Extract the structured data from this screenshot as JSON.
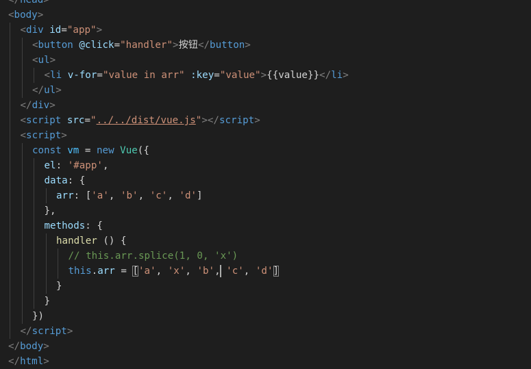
{
  "editor": {
    "lines": [
      {
        "indent": 0,
        "tokens": [
          {
            "c": "t-bracket",
            "t": "</"
          },
          {
            "c": "t-tag",
            "t": "head"
          },
          {
            "c": "t-bracket",
            "t": ">"
          }
        ]
      },
      {
        "indent": 0,
        "tokens": [
          {
            "c": "t-bracket",
            "t": "<"
          },
          {
            "c": "t-tag",
            "t": "body"
          },
          {
            "c": "t-bracket",
            "t": ">"
          }
        ]
      },
      {
        "indent": 1,
        "tokens": [
          {
            "c": "t-bracket",
            "t": "<"
          },
          {
            "c": "t-tag",
            "t": "div"
          },
          {
            "c": "t-text",
            "t": " "
          },
          {
            "c": "t-attr",
            "t": "id"
          },
          {
            "c": "t-text",
            "t": "="
          },
          {
            "c": "t-str",
            "t": "\"app\""
          },
          {
            "c": "t-bracket",
            "t": ">"
          }
        ]
      },
      {
        "indent": 2,
        "tokens": [
          {
            "c": "t-bracket",
            "t": "<"
          },
          {
            "c": "t-tag",
            "t": "button"
          },
          {
            "c": "t-text",
            "t": " "
          },
          {
            "c": "t-attr",
            "t": "@click"
          },
          {
            "c": "t-text",
            "t": "="
          },
          {
            "c": "t-str",
            "t": "\"handler\""
          },
          {
            "c": "t-bracket",
            "t": ">"
          },
          {
            "c": "t-text",
            "t": "按钮"
          },
          {
            "c": "t-bracket",
            "t": "</"
          },
          {
            "c": "t-tag",
            "t": "button"
          },
          {
            "c": "t-bracket",
            "t": ">"
          }
        ]
      },
      {
        "indent": 2,
        "tokens": [
          {
            "c": "t-bracket",
            "t": "<"
          },
          {
            "c": "t-tag",
            "t": "ul"
          },
          {
            "c": "t-bracket",
            "t": ">"
          }
        ]
      },
      {
        "indent": 3,
        "tokens": [
          {
            "c": "t-bracket",
            "t": "<"
          },
          {
            "c": "t-tag",
            "t": "li"
          },
          {
            "c": "t-text",
            "t": " "
          },
          {
            "c": "t-attr",
            "t": "v-for"
          },
          {
            "c": "t-text",
            "t": "="
          },
          {
            "c": "t-str",
            "t": "\"value in arr\""
          },
          {
            "c": "t-text",
            "t": " "
          },
          {
            "c": "t-attr",
            "t": ":key"
          },
          {
            "c": "t-text",
            "t": "="
          },
          {
            "c": "t-str",
            "t": "\"value\""
          },
          {
            "c": "t-bracket",
            "t": ">"
          },
          {
            "c": "t-text",
            "t": "{{value}}"
          },
          {
            "c": "t-bracket",
            "t": "</"
          },
          {
            "c": "t-tag",
            "t": "li"
          },
          {
            "c": "t-bracket",
            "t": ">"
          }
        ]
      },
      {
        "indent": 2,
        "tokens": [
          {
            "c": "t-bracket",
            "t": "</"
          },
          {
            "c": "t-tag",
            "t": "ul"
          },
          {
            "c": "t-bracket",
            "t": ">"
          }
        ]
      },
      {
        "indent": 1,
        "tokens": [
          {
            "c": "t-bracket",
            "t": "</"
          },
          {
            "c": "t-tag",
            "t": "div"
          },
          {
            "c": "t-bracket",
            "t": ">"
          }
        ]
      },
      {
        "indent": 1,
        "tokens": [
          {
            "c": "t-bracket",
            "t": "<"
          },
          {
            "c": "t-tag",
            "t": "script"
          },
          {
            "c": "t-text",
            "t": " "
          },
          {
            "c": "t-attr",
            "t": "src"
          },
          {
            "c": "t-text",
            "t": "="
          },
          {
            "c": "t-str",
            "t": "\""
          },
          {
            "c": "t-url",
            "t": "../../dist/vue.js"
          },
          {
            "c": "t-str",
            "t": "\""
          },
          {
            "c": "t-bracket",
            "t": "></"
          },
          {
            "c": "t-tag",
            "t": "script"
          },
          {
            "c": "t-bracket",
            "t": ">"
          }
        ]
      },
      {
        "indent": 1,
        "tokens": [
          {
            "c": "t-bracket",
            "t": "<"
          },
          {
            "c": "t-tag",
            "t": "script"
          },
          {
            "c": "t-bracket",
            "t": ">"
          }
        ]
      },
      {
        "indent": 2,
        "tokens": [
          {
            "c": "t-kw",
            "t": "const"
          },
          {
            "c": "t-text",
            "t": " "
          },
          {
            "c": "t-var",
            "t": "vm"
          },
          {
            "c": "t-text",
            "t": " = "
          },
          {
            "c": "t-kw",
            "t": "new"
          },
          {
            "c": "t-text",
            "t": " "
          },
          {
            "c": "t-class",
            "t": "Vue"
          },
          {
            "c": "t-punc",
            "t": "({"
          }
        ]
      },
      {
        "indent": 3,
        "tokens": [
          {
            "c": "t-prop",
            "t": "el"
          },
          {
            "c": "t-punc",
            "t": ": "
          },
          {
            "c": "t-str",
            "t": "'#app'"
          },
          {
            "c": "t-punc",
            "t": ","
          }
        ]
      },
      {
        "indent": 3,
        "tokens": [
          {
            "c": "t-prop",
            "t": "data"
          },
          {
            "c": "t-punc",
            "t": ": {"
          }
        ]
      },
      {
        "indent": 4,
        "tokens": [
          {
            "c": "t-prop",
            "t": "arr"
          },
          {
            "c": "t-punc",
            "t": ": ["
          },
          {
            "c": "t-str",
            "t": "'a'"
          },
          {
            "c": "t-punc",
            "t": ", "
          },
          {
            "c": "t-str",
            "t": "'b'"
          },
          {
            "c": "t-punc",
            "t": ", "
          },
          {
            "c": "t-str",
            "t": "'c'"
          },
          {
            "c": "t-punc",
            "t": ", "
          },
          {
            "c": "t-str",
            "t": "'d'"
          },
          {
            "c": "t-punc",
            "t": "]"
          }
        ]
      },
      {
        "indent": 3,
        "tokens": [
          {
            "c": "t-punc",
            "t": "},"
          }
        ]
      },
      {
        "indent": 3,
        "tokens": [
          {
            "c": "t-prop",
            "t": "methods"
          },
          {
            "c": "t-punc",
            "t": ": {"
          }
        ]
      },
      {
        "indent": 4,
        "tokens": [
          {
            "c": "t-fn",
            "t": "handler"
          },
          {
            "c": "t-text",
            "t": " "
          },
          {
            "c": "t-punc",
            "t": "() {"
          }
        ]
      },
      {
        "indent": 5,
        "tokens": [
          {
            "c": "t-comment",
            "t": "// this.arr.splice(1, 0, 'x')"
          }
        ]
      },
      {
        "indent": 5,
        "tokens": [
          {
            "c": "t-kw",
            "t": "this"
          },
          {
            "c": "t-punc",
            "t": "."
          },
          {
            "c": "t-prop",
            "t": "arr"
          },
          {
            "c": "t-punc",
            "t": " = "
          },
          {
            "c": "t-punc match-box",
            "t": "["
          },
          {
            "c": "t-str",
            "t": "'a'"
          },
          {
            "c": "t-punc",
            "t": ", "
          },
          {
            "c": "t-str",
            "t": "'x'"
          },
          {
            "c": "t-punc",
            "t": ", "
          },
          {
            "c": "t-str",
            "t": "'b'"
          },
          {
            "c": "t-punc cursor-after",
            "t": ","
          },
          {
            "c": "t-punc",
            "t": " "
          },
          {
            "c": "t-str",
            "t": "'c'"
          },
          {
            "c": "t-punc",
            "t": ", "
          },
          {
            "c": "t-str",
            "t": "'d'"
          },
          {
            "c": "t-punc match-box",
            "t": "]"
          }
        ]
      },
      {
        "indent": 4,
        "tokens": [
          {
            "c": "t-punc",
            "t": "}"
          }
        ]
      },
      {
        "indent": 3,
        "tokens": [
          {
            "c": "t-punc",
            "t": "}"
          }
        ]
      },
      {
        "indent": 2,
        "tokens": [
          {
            "c": "t-punc",
            "t": "})"
          }
        ]
      },
      {
        "indent": 1,
        "tokens": [
          {
            "c": "t-bracket",
            "t": "</"
          },
          {
            "c": "t-tag",
            "t": "script"
          },
          {
            "c": "t-bracket",
            "t": ">"
          }
        ]
      },
      {
        "indent": 0,
        "tokens": [
          {
            "c": "t-bracket",
            "t": "</"
          },
          {
            "c": "t-tag",
            "t": "body"
          },
          {
            "c": "t-bracket",
            "t": ">"
          }
        ]
      },
      {
        "indent": 0,
        "tokens": [
          {
            "c": "t-bracket",
            "t": "</"
          },
          {
            "c": "t-tag",
            "t": "html"
          },
          {
            "c": "t-bracket",
            "t": ">"
          }
        ]
      }
    ]
  },
  "theme": {
    "background": "#1e1e1e",
    "guide_color": "#404040",
    "cursor_color": "#aeafad"
  }
}
